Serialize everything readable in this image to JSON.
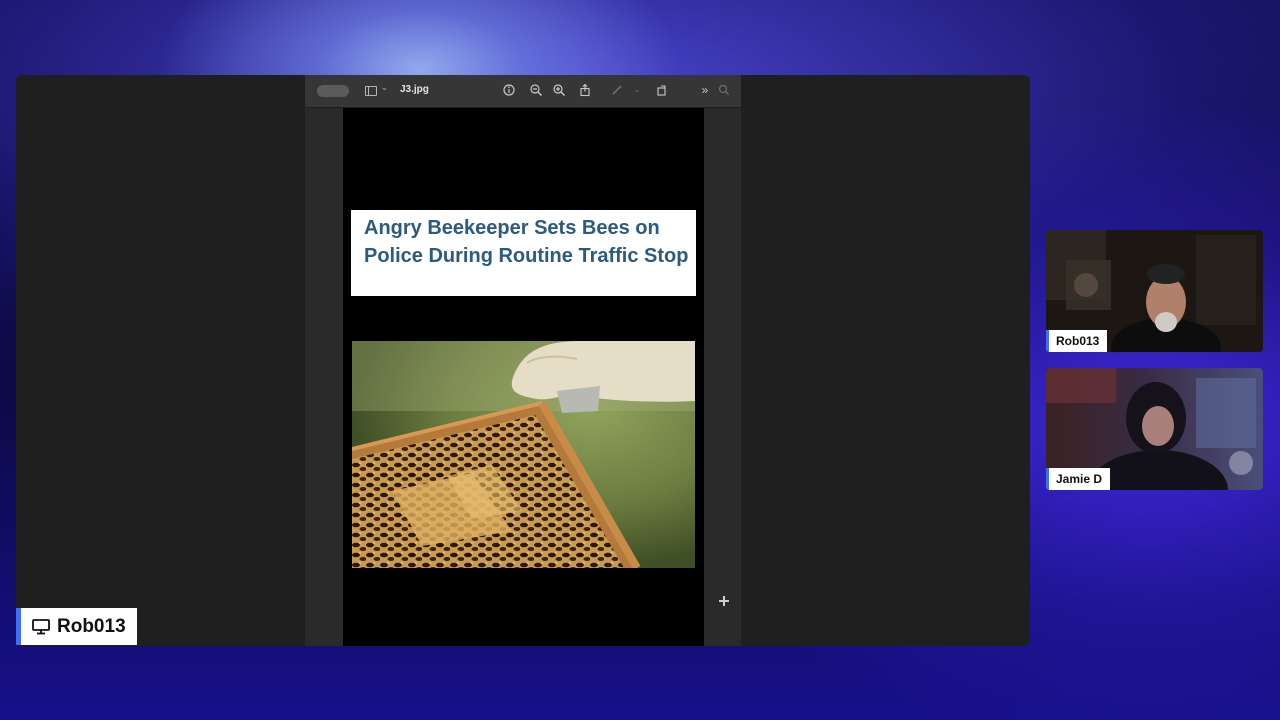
{
  "viewer": {
    "file_name": "J3.jpg",
    "icons": {
      "sidebar": "sidebar-icon",
      "info": "info-icon",
      "zoom_out": "zoom-out-icon",
      "zoom_in": "zoom-in-icon",
      "share": "share-icon",
      "markup": "pen-icon",
      "rotate": "rotate-icon",
      "more": "chevron-double-right-icon",
      "search": "search-icon"
    }
  },
  "document": {
    "headline": "Angry Beekeeper Sets Bees on Police During Routine Traffic Stop",
    "headline_color": "#2b5b7e"
  },
  "presenter": {
    "name": "Rob013",
    "icon": "monitor-icon",
    "accent": "#3d6ef5"
  },
  "participants": [
    {
      "name": "Rob013"
    },
    {
      "name": "Jamie D"
    }
  ]
}
